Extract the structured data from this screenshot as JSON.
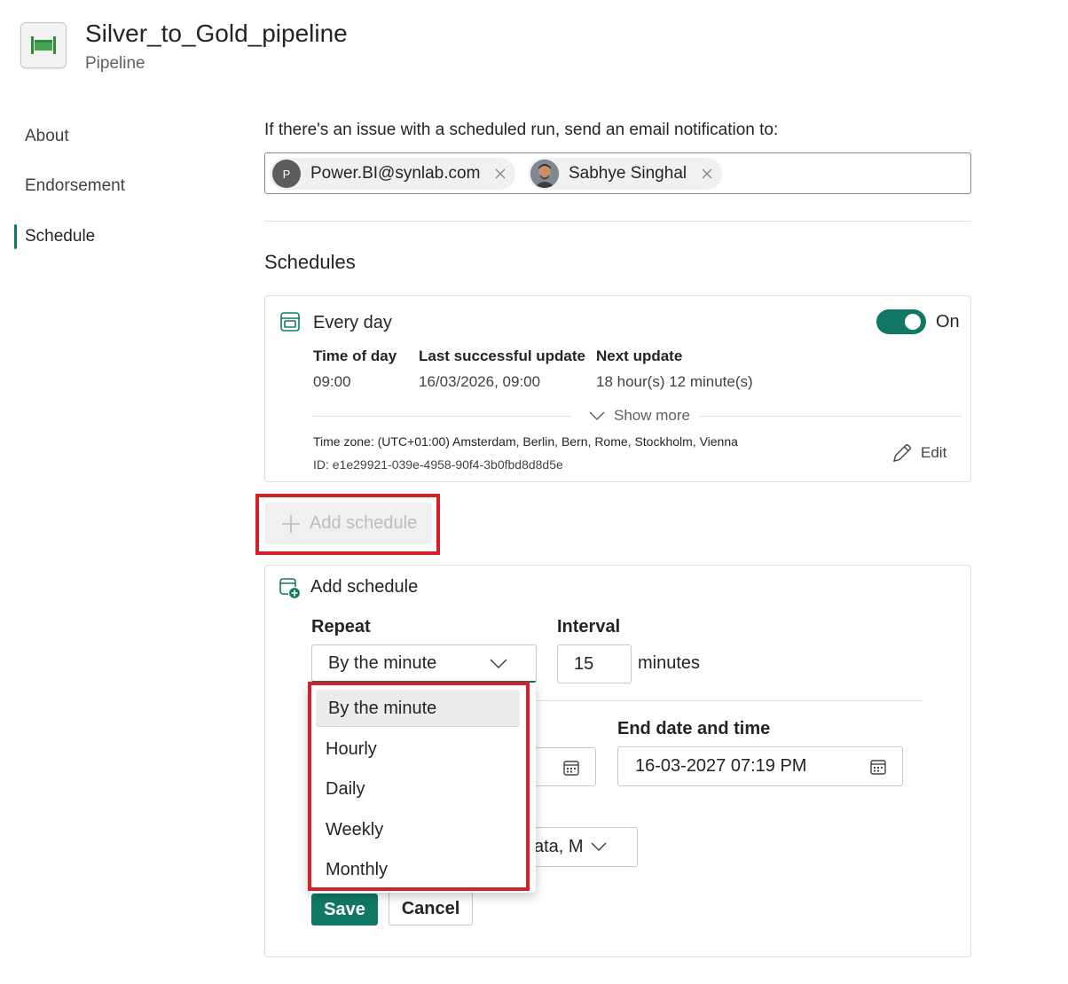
{
  "header": {
    "title": "Silver_to_Gold_pipeline",
    "subtitle": "Pipeline",
    "icon": "pipeline-icon"
  },
  "nav": {
    "items": [
      {
        "label": "About"
      },
      {
        "label": "Endorsement"
      },
      {
        "label": "Schedule",
        "active": true
      }
    ]
  },
  "notification": {
    "label": "If there's an issue with a scheduled run, send an email notification to:",
    "recipients": [
      {
        "initial": "P",
        "name": "Power.BI@synlab.com"
      },
      {
        "name": "Sabhye Singhal"
      }
    ]
  },
  "schedules": {
    "title": "Schedules",
    "card": {
      "title": "Every day",
      "toggle_label": "On",
      "toggle_on": true,
      "columns": [
        {
          "header": "Time of day",
          "value": "09:00"
        },
        {
          "header": "Last successful update",
          "value": "16/03/2026, 09:00"
        },
        {
          "header": "Next update",
          "value": "18 hour(s) 12 minute(s)"
        }
      ],
      "show_more": "Show more",
      "timezone": "Time zone: (UTC+01:00) Amsterdam, Berlin, Bern, Rome, Stockholm, Vienna",
      "id": "ID: e1e29921-039e-4958-90f4-3b0fbd8d8d5e",
      "edit_label": "Edit"
    },
    "add_button": "Add schedule"
  },
  "form": {
    "title": "Add schedule",
    "repeat_label": "Repeat",
    "repeat_value": "By the minute",
    "interval_label": "Interval",
    "interval_value": "15",
    "interval_unit": "minutes",
    "end_label": "End date and time",
    "end_value": "16-03-2027 07:19 PM",
    "timezone_partial": "ata, M",
    "save": "Save",
    "cancel": "Cancel"
  },
  "dropdown": {
    "options": [
      "By the minute",
      "Hourly",
      "Daily",
      "Weekly",
      "Monthly"
    ],
    "selected": "By the minute"
  },
  "colors": {
    "accent": "#117865",
    "highlight": "#d71f27"
  }
}
